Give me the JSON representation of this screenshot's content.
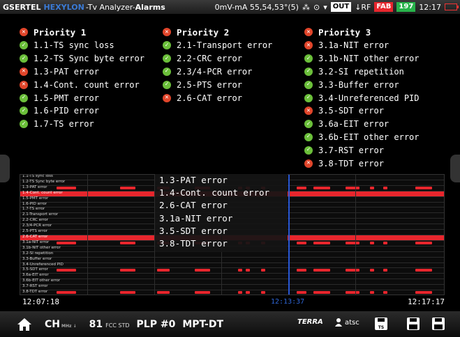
{
  "topbar": {
    "brand": "GSERTEL",
    "product": "HEXYLON",
    "title_prefix": "-Tv Analyzer-",
    "title_mode": "Alarms",
    "signal": "0mV-mA 55,54,53°(5)",
    "out_label": "OUT",
    "rf_label": "↓RF",
    "fab_label": "FAB",
    "count": "197",
    "time": "12:17",
    "colors": {
      "fab": "#e8262d",
      "count": "#27b34a",
      "product": "#3b7bd6"
    }
  },
  "priorities": [
    {
      "title": "Priority 1",
      "status": "error",
      "items": [
        {
          "label": "1.1-TS sync loss",
          "status": "ok"
        },
        {
          "label": "1.2-TS Sync byte error",
          "status": "ok"
        },
        {
          "label": "1.3-PAT error",
          "status": "error"
        },
        {
          "label": "1.4-Cont. count error",
          "status": "error"
        },
        {
          "label": "1.5-PMT error",
          "status": "ok"
        },
        {
          "label": "1.6-PID error",
          "status": "ok"
        },
        {
          "label": "1.7-TS error",
          "status": "ok"
        }
      ]
    },
    {
      "title": "Priority 2",
      "status": "error",
      "items": [
        {
          "label": "2.1-Transport error",
          "status": "ok"
        },
        {
          "label": "2.2-CRC error",
          "status": "ok"
        },
        {
          "label": "2.3/4-PCR error",
          "status": "ok"
        },
        {
          "label": "2.5-PTS error",
          "status": "ok"
        },
        {
          "label": "2.6-CAT error",
          "status": "error"
        }
      ]
    },
    {
      "title": "Priority 3",
      "status": "error",
      "items": [
        {
          "label": "3.1a-NIT error",
          "status": "error"
        },
        {
          "label": "3.1b-NIT other error",
          "status": "ok"
        },
        {
          "label": "3.2-SI repetition",
          "status": "ok"
        },
        {
          "label": "3.3-Buffer error",
          "status": "ok"
        },
        {
          "label": "3.4-Unreferenced PID",
          "status": "ok"
        },
        {
          "label": "3.5-SDT error",
          "status": "error"
        },
        {
          "label": "3.6a-EIT error",
          "status": "ok"
        },
        {
          "label": "3.6b-EIT other error",
          "status": "ok"
        },
        {
          "label": "3.7-RST error",
          "status": "ok"
        },
        {
          "label": "3.8-TDT error",
          "status": "error"
        }
      ]
    }
  ],
  "timeline": {
    "rows": [
      "1.1-TS sync loss",
      "1.2-TS Sync byte error",
      "1.3-PAT error",
      "1.4-Cont. count error",
      "1.5-PMT error",
      "1.6-PID error",
      "1.7-TS error",
      "2.1-Transport error",
      "2.2-CRC error",
      "2.3/4-PCR error",
      "2.5-PTS error",
      "2.6-CAT error",
      "3.1a-NIT error",
      "3.1b-NIT other error",
      "3.2-SI repetition",
      "3.3-Buffer error",
      "3.4-Unreferenced PID",
      "3.5-SDT error",
      "3.6a-EIT error",
      "3.6b-EIT other error",
      "3.7-RST error",
      "3.8-TDT error"
    ],
    "red_rows": [
      3,
      11
    ],
    "segment_rows": [
      2,
      12,
      17,
      21
    ],
    "cursor_fraction": 0.63,
    "start_time": "12:07:18",
    "cursor_time": "12:13:37",
    "end_time": "12:17:17",
    "colors": {
      "error": "#e8262d",
      "cursor": "#2857d4"
    }
  },
  "overlay": {
    "items": [
      "1.3-PAT error",
      "1.4-Cont. count error",
      "2.6-CAT error",
      "3.1a-NIT error",
      "3.5-SDT error",
      "3.8-TDT error"
    ]
  },
  "bottombar": {
    "home_icon": "home-icon",
    "ch_label": "CH",
    "ch_sub": "MHz ↓",
    "channel": "81",
    "channel_unit": "FCC STD",
    "plp": "PLP #0",
    "mode": "MPT-DT",
    "terra": "TERRA",
    "user_label": "atsc",
    "ts_label": "TS"
  }
}
